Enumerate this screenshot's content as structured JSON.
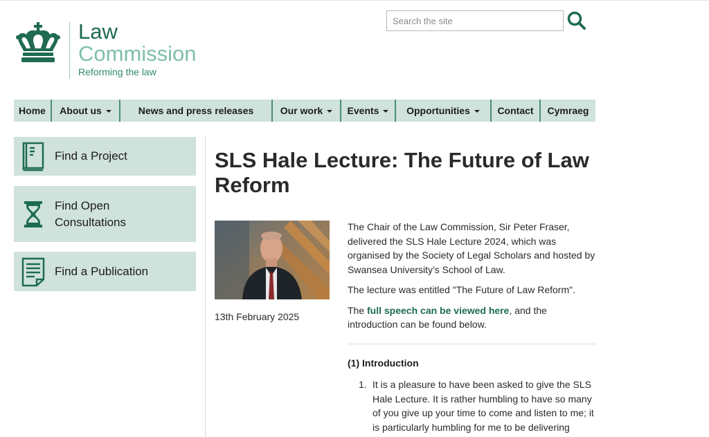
{
  "header": {
    "logo_line1": "Law",
    "logo_line2": "Commission",
    "tagline": "Reforming the law",
    "search_placeholder": "Search the site"
  },
  "nav": {
    "items": [
      {
        "label": "Home",
        "dropdown": false
      },
      {
        "label": "About us",
        "dropdown": true
      },
      {
        "label": "News and press releases",
        "dropdown": false
      },
      {
        "label": "Our work",
        "dropdown": true
      },
      {
        "label": "Events",
        "dropdown": true
      },
      {
        "label": "Opportunities",
        "dropdown": true
      },
      {
        "label": "Contact",
        "dropdown": false
      },
      {
        "label": "Cymraeg",
        "dropdown": false
      }
    ]
  },
  "sidebar": {
    "cards": [
      {
        "line1": "Find a Project",
        "line2": "",
        "icon": "book-icon"
      },
      {
        "line1": "Find Open",
        "line2": "Consultations",
        "icon": "hourglass-icon"
      },
      {
        "line1": "Find a Publication",
        "line2": "",
        "icon": "document-icon"
      }
    ]
  },
  "article": {
    "title": "SLS Hale Lecture: The Future of Law Reform",
    "date": "13th February 2025",
    "para1": "The Chair of the Law Commission, Sir Peter Fraser, delivered the SLS Hale Lecture 2024, which was organised by the Society of Legal Scholars and hosted by Swansea University’s School of Law.",
    "para2": "The lecture was entitled \"The Future of Law Reform\".",
    "para3_pre": "The ",
    "para3_link": "full speech can be viewed here",
    "para3_post": ", and the introduction can be found below.",
    "intro_heading": "(1) Introduction",
    "list_number": "1.",
    "list_text": "It is a pleasure to have been asked to give the SLS Hale Lecture. It is rather humbling to have so many of you give up your time to come and listen to me; it is particularly humbling for me to be delivering"
  },
  "colors": {
    "brand_dark": "#1e6b50",
    "brand_light": "#7fbfa8",
    "nav_bg": "#cfe2dc",
    "nav_divider": "#4d8c75"
  }
}
